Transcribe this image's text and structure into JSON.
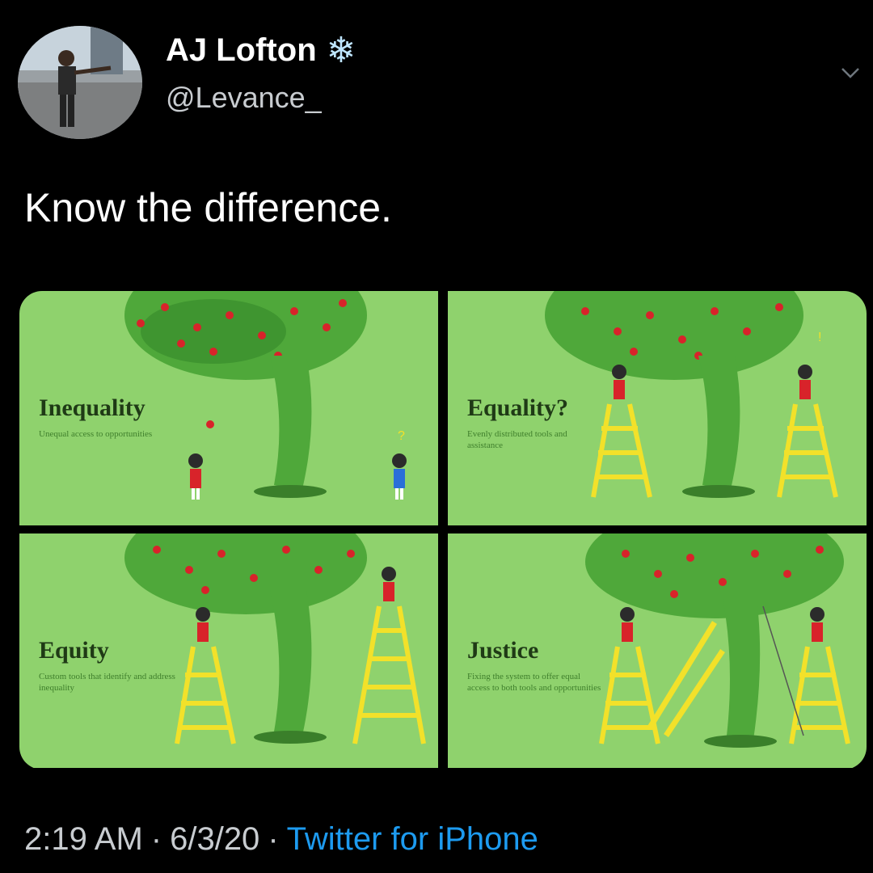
{
  "tweet": {
    "display_name": "AJ Lofton",
    "handle": "@Levance_",
    "name_emoji": "❄",
    "text": "Know the difference.",
    "time": "2:19 AM",
    "date": "6/3/20",
    "source": "Twitter for iPhone",
    "separator": "·"
  },
  "panels": [
    {
      "title": "Inequality",
      "subtitle": "Unequal access to opportunities"
    },
    {
      "title": "Equality?",
      "subtitle": "Evenly distributed tools and assistance"
    },
    {
      "title": "Equity",
      "subtitle": "Custom tools that identify and address inequality"
    },
    {
      "title": "Justice",
      "subtitle": "Fixing the system to offer equal access to both tools and opportunities"
    }
  ],
  "colors": {
    "background": "#000000",
    "panel_green": "#8fd26d",
    "tree_green": "#4fa83a",
    "apple_red": "#d8232a",
    "ladder_yellow": "#f2e12a",
    "link_blue": "#1d9bf0"
  },
  "icons": {
    "verified_like": "snowflake-icon",
    "menu": "chevron-down-icon"
  }
}
